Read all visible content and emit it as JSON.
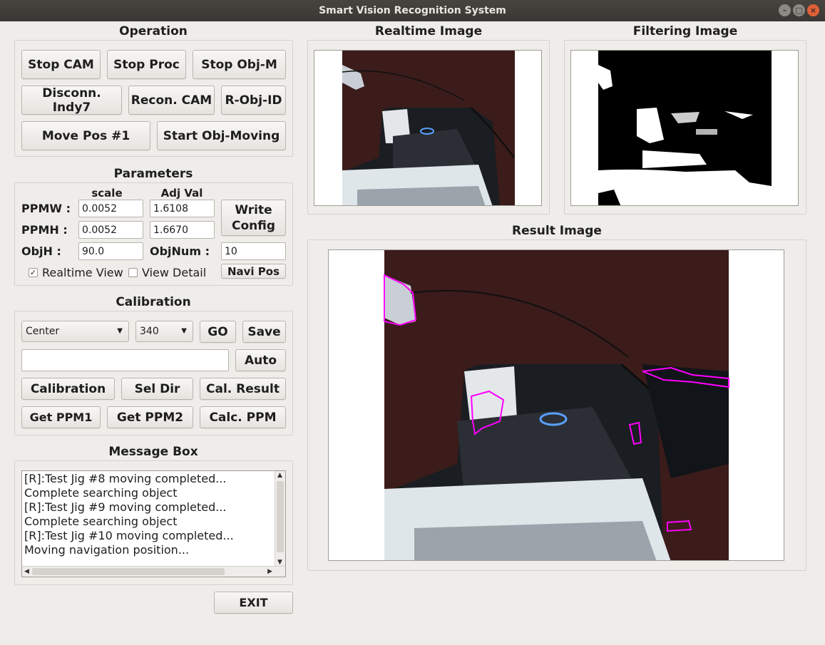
{
  "window": {
    "title": "Smart Vision Recognition System"
  },
  "sections": {
    "operation": "Operation",
    "parameters": "Parameters",
    "calibration": "Calibration",
    "message_box": "Message Box",
    "realtime_image": "Realtime Image",
    "filtering_image": "Filtering Image",
    "result_image": "Result Image"
  },
  "operation": {
    "stop_cam": "Stop CAM",
    "stop_proc": "Stop Proc",
    "stop_obj_m": "Stop Obj-M",
    "disconn_indy7": "Disconn. Indy7",
    "recon_cam": "Recon. CAM",
    "r_obj_id": "R-Obj-ID",
    "move_pos": "Move Pos #1",
    "start_obj_moving": "Start Obj-Moving"
  },
  "parameters": {
    "col_scale": "scale",
    "col_adj": "Adj Val",
    "ppmw_label": "PPMW :",
    "ppmh_label": "PPMH :",
    "objh_label": "ObjH :",
    "objnum_label": "ObjNum :",
    "ppmw_scale": "0.0052",
    "ppmw_adj": "1.6108",
    "ppmh_scale": "0.0052",
    "ppmh_adj": "1.6670",
    "objh": "90.0",
    "objnum": "10",
    "write_config": "Write Config",
    "navi_pos": "Navi Pos",
    "realtime_view": "Realtime View",
    "realtime_view_checked": true,
    "view_detail": "View Detail",
    "view_detail_checked": false
  },
  "calibration": {
    "position_select": "Center",
    "value_select": "340",
    "go": "GO",
    "save": "Save",
    "text_input": "",
    "auto": "Auto",
    "calibration_btn": "Calibration",
    "sel_dir": "Sel Dir",
    "cal_result": "Cal. Result",
    "get_ppm1": "Get PPM1",
    "get_ppm2": "Get PPM2",
    "calc_ppm": "Calc. PPM"
  },
  "messages": [
    "[R]:Test Jig #8 moving completed...",
    "Complete searching object",
    "[R]:Test Jig #9 moving completed...",
    "Complete searching object",
    "[R]:Test Jig #10 moving completed...",
    "Moving navigation position..."
  ],
  "exit": "EXIT",
  "colors": {
    "contour": "#ff00ff",
    "titlebar": "#3d3b37",
    "background": "#efedea"
  }
}
